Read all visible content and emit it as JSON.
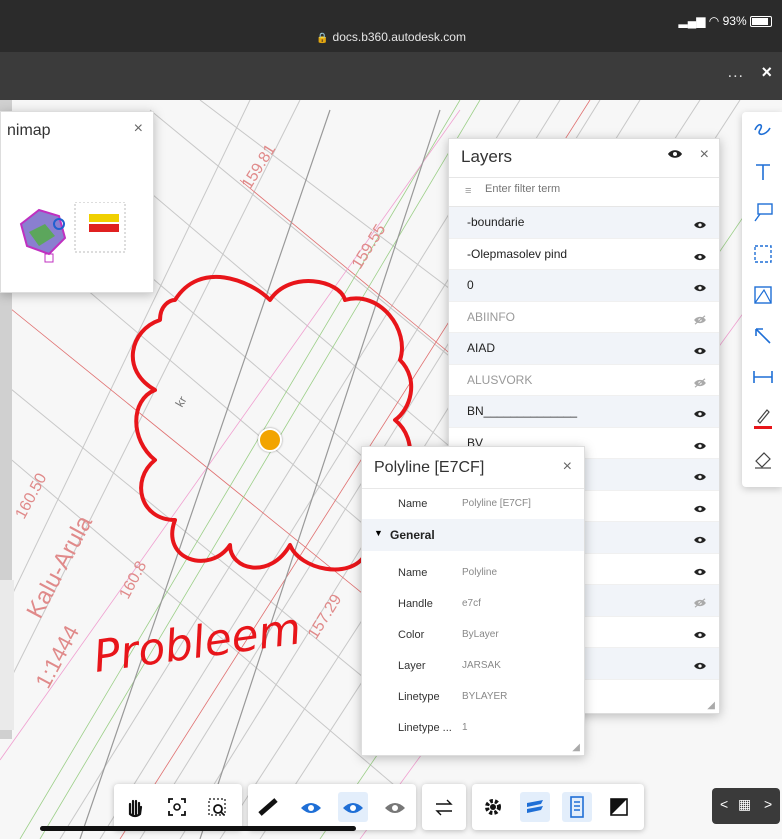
{
  "status": {
    "url": "docs.b360.autodesk.com",
    "battery": "93%"
  },
  "appbar": {
    "more": "...",
    "close": "×"
  },
  "drawing": {
    "labels": [
      "159.81",
      "159.55",
      "160.50",
      "160.8",
      "157.29",
      "kr",
      "Kalu-Arula",
      "1:1444"
    ],
    "markup_text": "Probleem"
  },
  "minimap": {
    "title": "nimap",
    "close": "×"
  },
  "layers": {
    "title": "Layers",
    "filter_placeholder": "Enter filter term",
    "items": [
      {
        "label": "-boundarie",
        "visible": true
      },
      {
        "label": "-Olepmasolev pind",
        "visible": true
      },
      {
        "label": "0",
        "visible": true
      },
      {
        "label": "ABIINFO",
        "visible": false
      },
      {
        "label": "AIAD",
        "visible": true
      },
      {
        "label": "ALUSVORK",
        "visible": false
      },
      {
        "label": "BN______________",
        "visible": true
      },
      {
        "label": "BV_____________",
        "visible": true
      },
      {
        "label": "",
        "visible": true
      },
      {
        "label": "",
        "visible": true
      },
      {
        "label": "",
        "visible": true
      },
      {
        "label": "",
        "visible": true
      },
      {
        "label": "",
        "visible": false
      },
      {
        "label": "",
        "visible": true
      },
      {
        "label": "",
        "visible": true
      }
    ]
  },
  "properties": {
    "title": "Polyline [E7CF]",
    "top_row": {
      "key": "Name",
      "value": "Polyline [E7CF]"
    },
    "section": "General",
    "rows": [
      {
        "key": "Name",
        "value": "Polyline"
      },
      {
        "key": "Handle",
        "value": "e7cf"
      },
      {
        "key": "Color",
        "value": "ByLayer"
      },
      {
        "key": "Layer",
        "value": "JARSAK"
      },
      {
        "key": "Linetype",
        "value": "BYLAYER"
      },
      {
        "key": "Linetype ...",
        "value": "1"
      }
    ]
  },
  "right_tools": [
    "freehand-icon",
    "text-icon",
    "callout-icon",
    "cloud-icon",
    "polygon-icon",
    "arrow-icon",
    "dimension-icon",
    "pen-color-icon",
    "eraser-icon"
  ],
  "bottom_tools": [
    "pan-icon",
    "fit-icon",
    "zoom-window-icon",
    "measure-icon",
    "camera-orbit-icon",
    "camera-look-icon",
    "camera-walk-icon",
    "compare-icon",
    "settings-icon",
    "layers-icon",
    "properties-icon",
    "sheets-icon"
  ],
  "pager": {
    "prev": "<",
    "grid": "▦",
    "next": ">"
  },
  "colors": {
    "markup_red": "#e8151a",
    "accent_blue": "#1f6fd6",
    "selected_dot": "#f2a400"
  }
}
